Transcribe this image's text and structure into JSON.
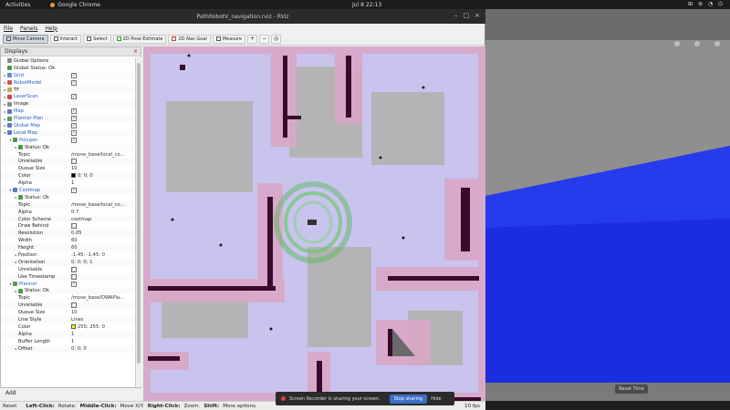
{
  "topbar": {
    "activities": "Activities",
    "app_name": "Google Chrome",
    "clock": "Jul 8  22:13",
    "tray": [
      "⊞",
      "⊛",
      "◔",
      "⏻"
    ]
  },
  "window": {
    "title": "PathRobotV_navigation.rviz - RViz",
    "controls": [
      "–",
      "□",
      "×"
    ]
  },
  "menu": [
    "File",
    "Panels",
    "Help"
  ],
  "toolbar": {
    "interact": "Move Camera",
    "select": "Interact",
    "select2": "Select",
    "pose_estimate": "2D Pose Estimate",
    "nav_goal": "2D Nav Goal",
    "measure": "Measure",
    "plus": "+",
    "minus": "−",
    "camera": "◎"
  },
  "displays": {
    "header": "Displays",
    "close": "×",
    "rows": [
      {
        "arrow": "",
        "indent": 0,
        "icon_color": "#888888",
        "name": "Global Options",
        "value": "",
        "check": "",
        "disp": false
      },
      {
        "arrow": "",
        "indent": 0,
        "icon_color": "#4a9a4a",
        "name": "Global Status: Ok",
        "value": "",
        "check": "",
        "disp": false
      },
      {
        "arrow": "▸",
        "indent": 0,
        "icon_color": "#6a8ac6",
        "name": "Grid",
        "value": "",
        "check": "✓",
        "disp": true
      },
      {
        "arrow": "▸",
        "indent": 0,
        "icon_color": "#c65a5a",
        "name": "RobotModel",
        "value": "",
        "check": "✓",
        "disp": true
      },
      {
        "arrow": "▸",
        "indent": 0,
        "icon_color": "#c6a84a",
        "name": "TF",
        "value": "",
        "check": "",
        "disp": false
      },
      {
        "arrow": "▸",
        "indent": 0,
        "icon_color": "#c64a4a",
        "name": "LaserScan",
        "value": "",
        "check": "✓",
        "disp": true
      },
      {
        "arrow": "▸",
        "indent": 0,
        "icon_color": "#8a8a8a",
        "name": "Image",
        "value": "",
        "check": "",
        "disp": false
      },
      {
        "arrow": "▸",
        "indent": 0,
        "icon_color": "#5a7ac6",
        "name": "Map",
        "value": "",
        "check": "✓",
        "disp": true
      },
      {
        "arrow": "▸",
        "indent": 0,
        "icon_color": "#5a9a5a",
        "name": "Planner Plan",
        "value": "",
        "check": "✓",
        "disp": true
      },
      {
        "arrow": "▸",
        "indent": 0,
        "icon_color": "#5a7ac6",
        "name": "Global Map",
        "value": "",
        "check": "✓",
        "disp": true
      },
      {
        "arrow": "▾",
        "indent": 0,
        "icon_color": "#5a7ac6",
        "name": "Local Map",
        "value": "",
        "check": "✓",
        "disp": true
      },
      {
        "arrow": "▾",
        "indent": 1,
        "icon_color": "#4a9a4a",
        "name": "Polygon",
        "value": "",
        "check": "✓",
        "disp": true
      },
      {
        "arrow": "▸",
        "indent": 2,
        "icon_color": "#4a9a4a",
        "name": "Status: Ok",
        "value": "",
        "check": "",
        "disp": false
      },
      {
        "arrow": "",
        "indent": 2,
        "icon_color": "",
        "name": "Topic",
        "value": "/move_base/local_co...",
        "check": "",
        "disp": false
      },
      {
        "arrow": "",
        "indent": 2,
        "icon_color": "",
        "name": "Unreliable",
        "value": "",
        "check": "□",
        "disp": false
      },
      {
        "arrow": "",
        "indent": 2,
        "icon_color": "",
        "name": "Queue Size",
        "value": "10",
        "check": "",
        "disp": false
      },
      {
        "arrow": "",
        "indent": 2,
        "icon_color": "",
        "name": "Color",
        "value": "0; 0; 0",
        "swatch": "#000000",
        "check": "",
        "disp": false
      },
      {
        "arrow": "",
        "indent": 2,
        "icon_color": "",
        "name": "Alpha",
        "value": "1",
        "check": "",
        "disp": false
      },
      {
        "arrow": "▾",
        "indent": 1,
        "icon_color": "#5a7ac6",
        "name": "Costmap",
        "value": "",
        "check": "✓",
        "disp": true
      },
      {
        "arrow": "▸",
        "indent": 2,
        "icon_color": "#4a9a4a",
        "name": "Status: Ok",
        "value": "",
        "check": "",
        "disp": false
      },
      {
        "arrow": "",
        "indent": 2,
        "icon_color": "",
        "name": "Topic",
        "value": "/move_base/local_co...",
        "check": "",
        "disp": false
      },
      {
        "arrow": "",
        "indent": 2,
        "icon_color": "",
        "name": "Alpha",
        "value": "0.7",
        "check": "",
        "disp": false
      },
      {
        "arrow": "",
        "indent": 2,
        "icon_color": "",
        "name": "Color Scheme",
        "value": "costmap",
        "check": "",
        "disp": false
      },
      {
        "arrow": "",
        "indent": 2,
        "icon_color": "",
        "name": "Draw Behind",
        "value": "",
        "check": "□",
        "disp": false
      },
      {
        "arrow": "",
        "indent": 2,
        "icon_color": "",
        "name": "Resolution",
        "value": "0.05",
        "check": "",
        "disp": false
      },
      {
        "arrow": "",
        "indent": 2,
        "icon_color": "",
        "name": "Width",
        "value": "60",
        "check": "",
        "disp": false
      },
      {
        "arrow": "",
        "indent": 2,
        "icon_color": "",
        "name": "Height",
        "value": "60",
        "check": "",
        "disp": false
      },
      {
        "arrow": "▸",
        "indent": 2,
        "icon_color": "",
        "name": "Position",
        "value": "-1.45; -1.45; 0",
        "check": "",
        "disp": false
      },
      {
        "arrow": "▸",
        "indent": 2,
        "icon_color": "",
        "name": "Orientation",
        "value": "0; 0; 0; 1",
        "check": "",
        "disp": false
      },
      {
        "arrow": "",
        "indent": 2,
        "icon_color": "",
        "name": "Unreliable",
        "value": "",
        "check": "□",
        "disp": false
      },
      {
        "arrow": "",
        "indent": 2,
        "icon_color": "",
        "name": "Use Timestamp",
        "value": "",
        "check": "□",
        "disp": false
      },
      {
        "arrow": "▾",
        "indent": 1,
        "icon_color": "#5a9a5a",
        "name": "Planner",
        "value": "",
        "check": "✓",
        "disp": true
      },
      {
        "arrow": "▸",
        "indent": 2,
        "icon_color": "#4a9a4a",
        "name": "Status: Ok",
        "value": "",
        "check": "",
        "disp": false
      },
      {
        "arrow": "",
        "indent": 2,
        "icon_color": "",
        "name": "Topic",
        "value": "/move_base/DWAPla...",
        "check": "",
        "disp": false
      },
      {
        "arrow": "",
        "indent": 2,
        "icon_color": "",
        "name": "Unreliable",
        "value": "",
        "check": "□",
        "disp": false
      },
      {
        "arrow": "",
        "indent": 2,
        "icon_color": "",
        "name": "Queue Size",
        "value": "10",
        "check": "",
        "disp": false
      },
      {
        "arrow": "",
        "indent": 2,
        "icon_color": "",
        "name": "Line Style",
        "value": "Lines",
        "check": "",
        "disp": false
      },
      {
        "arrow": "",
        "indent": 2,
        "icon_color": "",
        "name": "Color",
        "value": "255; 255; 0",
        "swatch": "#ffff00",
        "check": "",
        "disp": false
      },
      {
        "arrow": "",
        "indent": 2,
        "icon_color": "",
        "name": "Alpha",
        "value": "1",
        "check": "",
        "disp": false
      },
      {
        "arrow": "",
        "indent": 2,
        "icon_color": "",
        "name": "Buffer Length",
        "value": "1",
        "check": "",
        "disp": false
      },
      {
        "arrow": "▸",
        "indent": 2,
        "icon_color": "",
        "name": "Offset",
        "value": "0; 0; 0",
        "check": "",
        "disp": false
      }
    ],
    "add": "Add"
  },
  "statusbar": {
    "reset": "Reset",
    "left_click": "Left-Click:",
    "left_action": "Rotate.",
    "middle_click": "Middle-Click:",
    "middle_action": "Move X/Y.",
    "right_click": "Right-Click:",
    "right_action": "Zoom.",
    "shift": "Shift:",
    "shift_action": "More options.",
    "fps": "10 fps"
  },
  "recorder": {
    "message": "Screen Recorder is sharing your screen.",
    "stop": "Stop sharing",
    "hide": "Hide"
  },
  "sim": {
    "reset_label": "Reset Time"
  },
  "colors": {
    "costmap_inflation": "#d9a8c8",
    "costmap_free": "#c8c4ee",
    "obstacle": "#3a0a2a",
    "floor_blue": "#1a2ee0"
  }
}
